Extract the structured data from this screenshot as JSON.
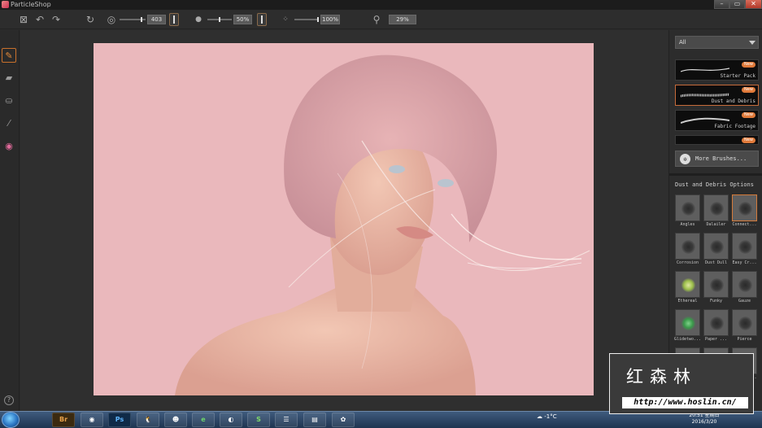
{
  "window": {
    "title": "ParticleShop",
    "min_label": "–",
    "max_label": "▭",
    "close_label": "✕"
  },
  "toolbar": {
    "clear_icon": "clear-layer-icon",
    "undo_icon": "undo-icon",
    "redo_icon": "redo-icon",
    "size_value": "403",
    "opacity_value": "50%",
    "grain_value": "100%",
    "zoom_value": "29%"
  },
  "tools": [
    {
      "name": "brush-tool",
      "glyph": "✎"
    },
    {
      "name": "eraser-tool",
      "glyph": "▰"
    },
    {
      "name": "paint-bucket-tool",
      "glyph": "⛀"
    },
    {
      "name": "dropper-tool",
      "glyph": "⁄"
    },
    {
      "name": "color-wheel-tool",
      "glyph": "◉"
    }
  ],
  "help_label": "?",
  "panel": {
    "category_select": "All",
    "categories": [
      {
        "label": "Starter Pack",
        "badge": "New"
      },
      {
        "label": "Dust and Debris",
        "badge": "New"
      },
      {
        "label": "Fabric Footage",
        "badge": "New"
      },
      {
        "label": "",
        "badge": "New"
      }
    ],
    "more_label": "More Brushes...",
    "options_title": "Dust and Debris Options",
    "brushes": [
      "Angles",
      "Dalailer",
      "Connect...",
      "Corrosion",
      "Dust Dull",
      "Easy Cr...",
      "Ethereal",
      "Funky",
      "Gauze",
      "Glidetwo...",
      "Paper ...",
      "Pierce",
      "",
      "",
      "Wild Cr..."
    ]
  },
  "taskbar": {
    "apps": [
      "Br",
      "",
      "Ps",
      "",
      "",
      "e",
      "",
      "S",
      "",
      "",
      ""
    ],
    "tray_temp": "-1°C",
    "clock_time": "20:51 星期日",
    "clock_date": "2016/3/20"
  },
  "watermark": {
    "logo_text": "红森林",
    "url": "http://www.hoslin.cn/"
  },
  "colors": {
    "accent": "#e07a3a",
    "canvas_bg": "#eab8bc"
  }
}
